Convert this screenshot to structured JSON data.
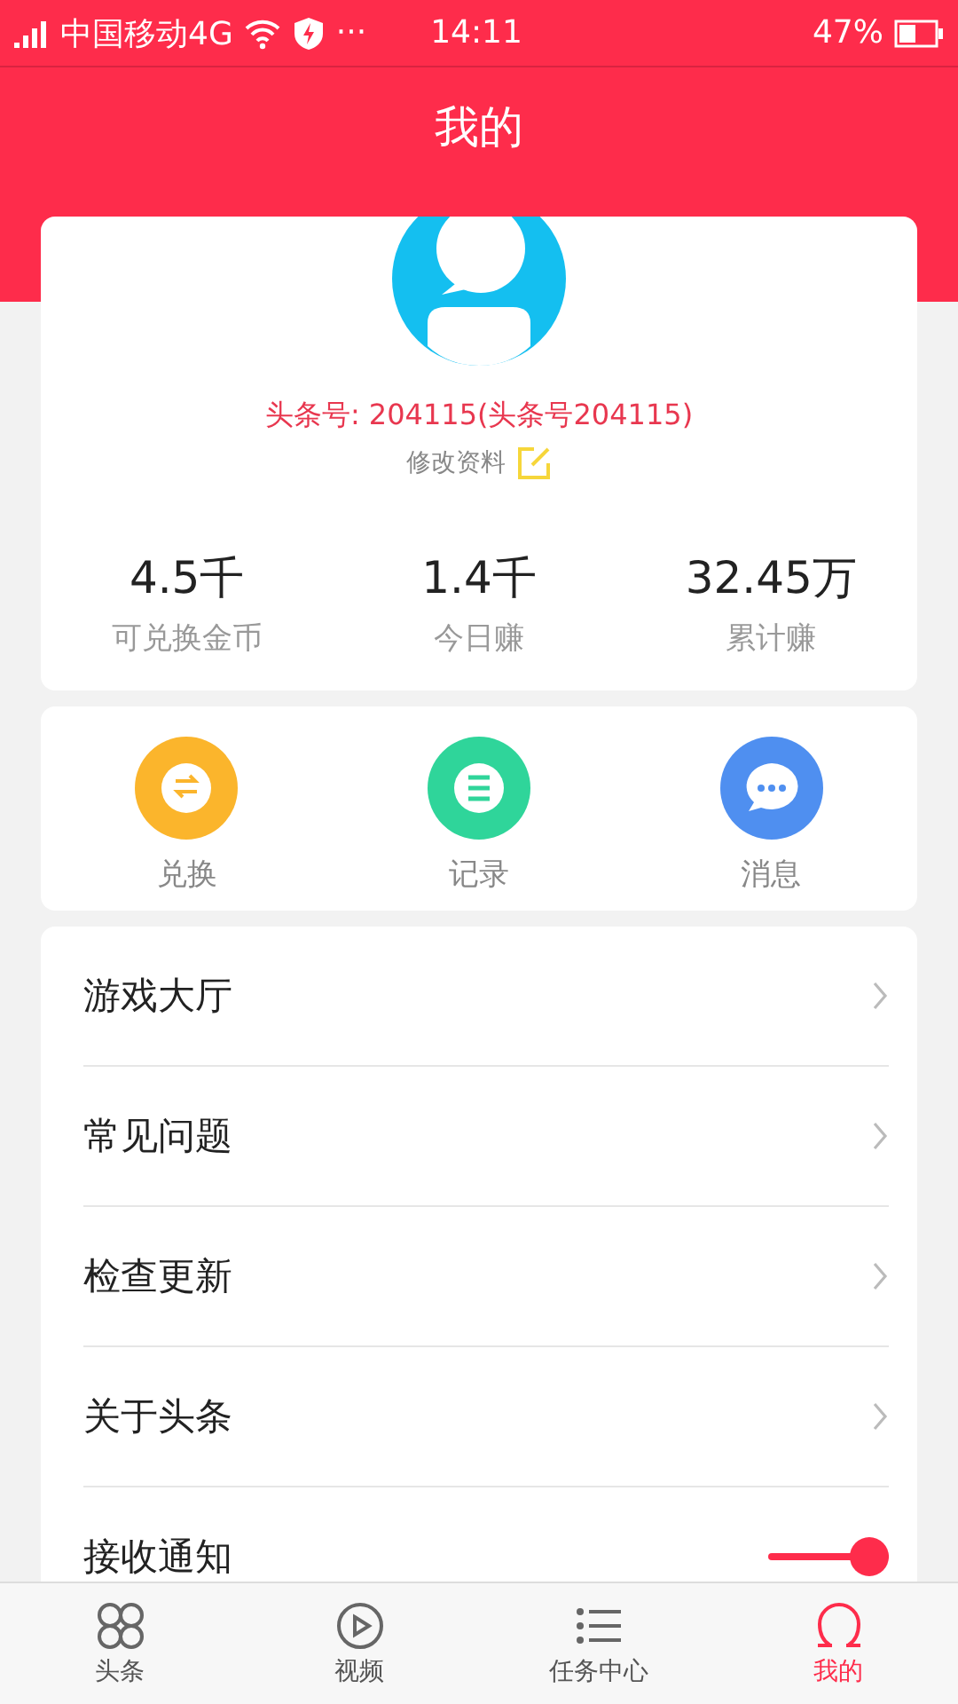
{
  "status_bar": {
    "carrier": "中国移动4G",
    "more": "···",
    "time": "14:11",
    "battery": "47%"
  },
  "header": {
    "title": "我的"
  },
  "profile": {
    "name": "头条号: 204115(头条号204115)",
    "edit": "修改资料"
  },
  "stats": [
    {
      "value": "4.5千",
      "label": "可兑换金币"
    },
    {
      "value": "1.4千",
      "label": "今日赚"
    },
    {
      "value": "32.45万",
      "label": "累计赚"
    }
  ],
  "actions": [
    {
      "kind": "exchange",
      "label": "兑换",
      "color": "#fbb52c"
    },
    {
      "kind": "record",
      "label": "记录",
      "color": "#2fd59a"
    },
    {
      "kind": "message",
      "label": "消息",
      "color": "#4f8ff0"
    }
  ],
  "menu": [
    {
      "kind": "link",
      "label": "游戏大厅"
    },
    {
      "kind": "link",
      "label": "常见问题"
    },
    {
      "kind": "link",
      "label": "检查更新"
    },
    {
      "kind": "link",
      "label": "关于头条"
    },
    {
      "kind": "toggle",
      "label": "接收通知",
      "on": true
    }
  ],
  "tabs": [
    {
      "kind": "clover",
      "label": "头条",
      "selected": false
    },
    {
      "kind": "play",
      "label": "视频",
      "selected": false
    },
    {
      "kind": "list",
      "label": "任务中心",
      "selected": false
    },
    {
      "kind": "person",
      "label": "我的",
      "selected": true
    }
  ]
}
